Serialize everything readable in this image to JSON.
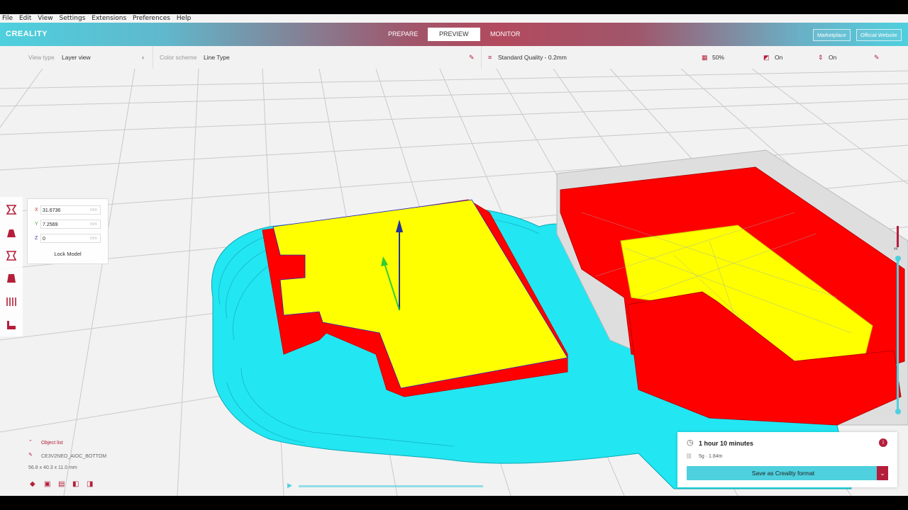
{
  "menu": [
    "File",
    "Edit",
    "View",
    "Settings",
    "Extensions",
    "Preferences",
    "Help"
  ],
  "header": {
    "logo": "CREALITY",
    "tabs": [
      "PREPARE",
      "PREVIEW",
      "MONITOR"
    ],
    "active_tab": "PREVIEW",
    "marketplace": "Marketplace",
    "official_website": "Official Website"
  },
  "view_settings": {
    "view_type_label": "View type",
    "view_type_value": "Layer view",
    "color_scheme_label": "Color scheme",
    "color_scheme_value": "Line Type"
  },
  "print_settings": {
    "profile": "Standard Quality - 0.2mm",
    "infill": "50%",
    "support": "On",
    "adhesion": "On"
  },
  "move_panel": {
    "x_label": "X",
    "x_value": "31.6736",
    "y_label": "Y",
    "y_value": "7.2569",
    "z_label": "Z",
    "z_value": "0",
    "unit": "mm",
    "lock_model": "Lock Model"
  },
  "object_list": {
    "title": "Object list",
    "name": "CE3V2NEO_AIOC_BOTTOM",
    "dimensions": "56.8 x 40.3 x 11.0 mm"
  },
  "layer_slider": {
    "label": "44"
  },
  "print_info": {
    "time": "1 hour 10 minutes",
    "material": "5g · 1.84m",
    "save_label": "Save as Creality format"
  },
  "colors": {
    "accent": "#b41e3a",
    "cyan": "#4ed0de",
    "infill": "#ffff00",
    "wall": "#ff0000",
    "skirt": "#22e6f2"
  }
}
